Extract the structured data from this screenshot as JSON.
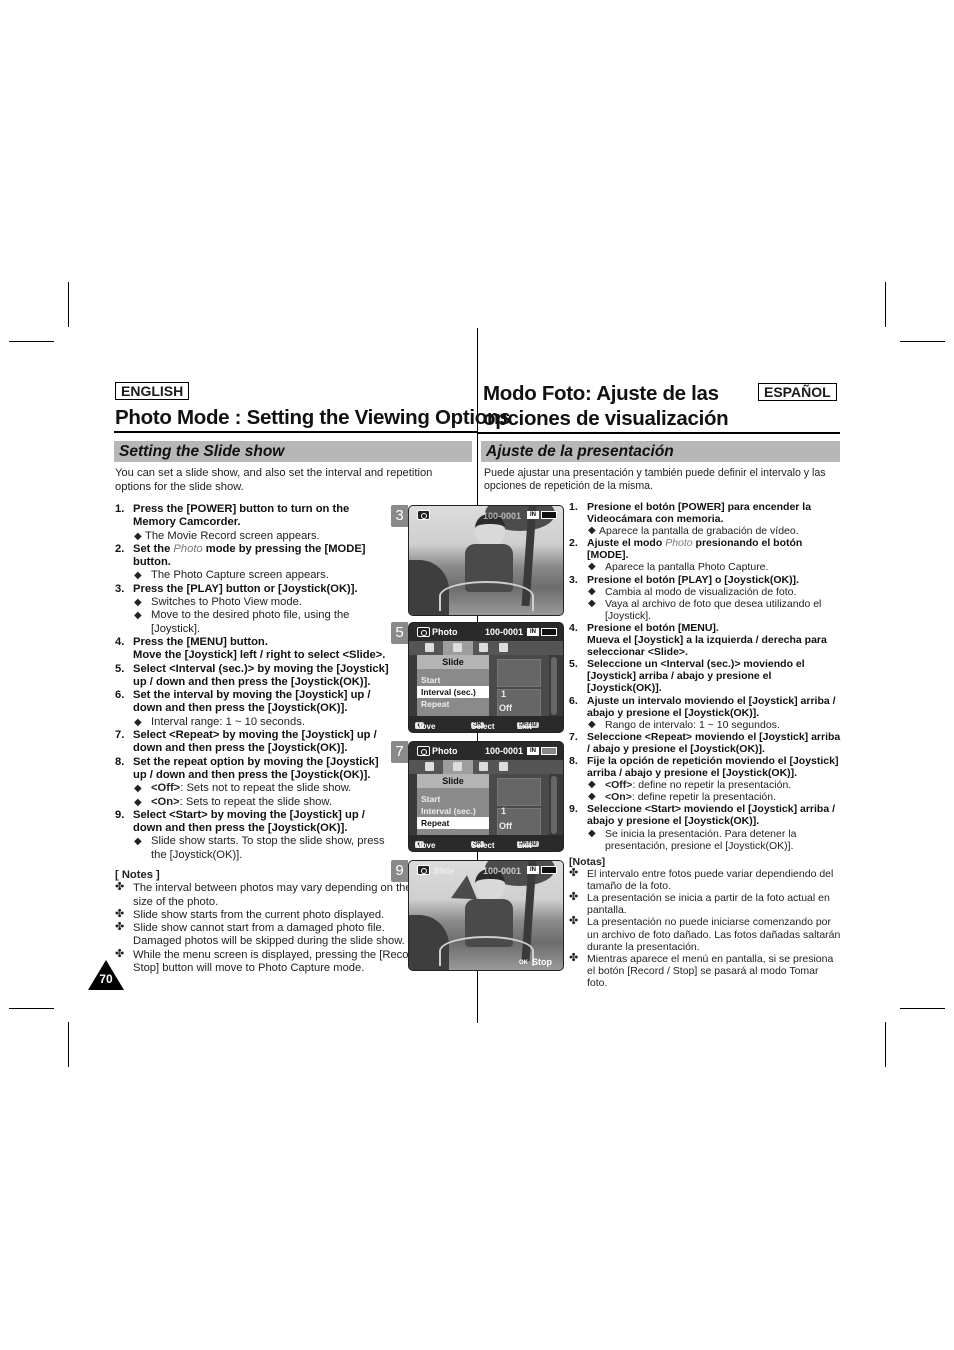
{
  "english": {
    "lang_label": "ENGLISH",
    "title": "Photo Mode : Setting the Viewing Options",
    "section": "Setting the Slide show",
    "intro": "You can set a slide show, and also set the interval and repetition options for the slide show.",
    "steps": [
      {
        "num": "1.",
        "text": "Press the [POWER] button to turn on the Memory Camcorder.",
        "subs": [
          "The Movie Record screen appears."
        ]
      },
      {
        "num": "2.",
        "pre": "Set the ",
        "italic": "Photo",
        "post": " mode by pressing the [MODE] button.",
        "subs": [
          "The Photo Capture screen appears."
        ]
      },
      {
        "num": "3.",
        "text": "Press the [PLAY] button or [Joystick(OK)].",
        "subs": [
          "Switches to Photo View mode.",
          "Move to the desired photo file, using the [Joystick]."
        ]
      },
      {
        "num": "4.",
        "text": "Press the [MENU] button.",
        "text2": "Move the [Joystick] left / right to select <Slide>."
      },
      {
        "num": "5.",
        "text": "Select <Interval (sec.)> by moving the [Joystick] up / down and then press the [Joystick(OK)]."
      },
      {
        "num": "6.",
        "text": "Set the interval by moving the [Joystick] up / down and then press the [Joystick(OK)].",
        "subs": [
          "Interval range: 1 ~ 10 seconds."
        ]
      },
      {
        "num": "7.",
        "text": "Select <Repeat> by moving the [Joystick] up / down and then press the [Joystick(OK)]."
      },
      {
        "num": "8.",
        "text": "Set the repeat option by moving the [Joystick] up / down and then press the [Joystick(OK)].",
        "subs_bold": [
          {
            "b": "<Off>",
            "t": ": Sets not to repeat the slide show."
          },
          {
            "b": "<On>",
            "t": ": Sets to repeat the slide show."
          }
        ]
      },
      {
        "num": "9.",
        "text": "Select <Start> by moving the [Joystick] up / down and then press the [Joystick(OK)].",
        "subs": [
          "Slide show starts. To stop the slide show, press the [Joystick(OK)]."
        ]
      }
    ],
    "notes_header": "[ Notes ]",
    "notes": [
      "The interval between photos may vary depending on the size of the photo.",
      "Slide show starts from the current photo displayed.",
      "Slide show cannot start from a damaged photo file. Damaged photos will be skipped during the slide show.",
      "While the menu screen is displayed, pressing the [Record / Stop] button will move to Photo Capture mode."
    ],
    "page_number": "70"
  },
  "spanish": {
    "lang_label": "ESPAÑOL",
    "title_line1": "Modo Foto: Ajuste de las",
    "title_line2": "opciones de visualización",
    "section": "Ajuste de la presentación",
    "intro": "Puede ajustar una presentación y también puede definir el intervalo y las opciones de repetición de la misma.",
    "steps": [
      {
        "num": "1.",
        "text": "Presione el botón [POWER] para encender la Videocámara con memoria.",
        "subs": [
          "Aparece la pantalla de grabación de vídeo."
        ]
      },
      {
        "num": "2.",
        "pre": "Ajuste el modo ",
        "italic": "Photo",
        "post": " presionando el botón [MODE].",
        "subs": [
          "Aparece la pantalla Photo Capture."
        ]
      },
      {
        "num": "3.",
        "text": "Presione el botón [PLAY] o [Joystick(OK)].",
        "subs": [
          "Cambia al modo de visualización de foto.",
          "Vaya al archivo de foto que desea utilizando el [Joystick]."
        ]
      },
      {
        "num": "4.",
        "text": "Presione el botón [MENU].",
        "text2": "Mueva el [Joystick] a la izquierda / derecha para seleccionar <Slide>."
      },
      {
        "num": "5.",
        "text": "Seleccione un <Interval (sec.)> moviendo el [Joystick] arriba / abajo y presione el [Joystick(OK)]."
      },
      {
        "num": "6.",
        "text": "Ajuste un intervalo moviendo el [Joystick] arriba / abajo y presione el [Joystick(OK)].",
        "subs": [
          "Rango de intervalo: 1 ~ 10 segundos."
        ]
      },
      {
        "num": "7.",
        "text": "Seleccione <Repeat> moviendo el [Joystick] arriba / abajo y presione el [Joystick(OK)]."
      },
      {
        "num": "8.",
        "text": "Fije la opción de repetición moviendo el [Joystick] arriba / abajo y presione el [Joystick(OK)].",
        "subs_bold": [
          {
            "b": "<Off>",
            "t": ": define no repetir la presentación."
          },
          {
            "b": "<On>",
            "t": ": define repetir la presentación."
          }
        ]
      },
      {
        "num": "9.",
        "text": "Seleccione <Start> moviendo el [Joystick] arriba / abajo y presione el [Joystick(OK)].",
        "subs": [
          "Se inicia la presentación. Para detener la presentación, presione el [Joystick(OK)]."
        ]
      }
    ],
    "notes_header": "[Notas]",
    "notes": [
      "El intervalo entre fotos puede variar dependiendo del tamaño de la foto.",
      "La presentación se inicia a partir de la foto actual en pantalla.",
      "La presentación no puede iniciarse comenzando por un archivo de foto dañado. Las fotos dañadas saltarán durante la presentación.",
      "Mientras aparece el menú en pantalla, si se presiona el botón [Record / Stop] se pasará al modo Tomar foto."
    ]
  },
  "screens": {
    "s3": {
      "label": "3",
      "file": "100-0001"
    },
    "s5": {
      "label": "5",
      "mode": "Photo",
      "file": "100-0001",
      "menu_title": "Slide",
      "items": [
        "Start",
        "Interval (sec.)",
        "Repeat"
      ],
      "active": 1,
      "interval_value": "1",
      "repeat_value": "Off",
      "bottom_move": "Move",
      "bottom_select": "Select",
      "bottom_exit": "Exit",
      "ok_key": "OK",
      "menu_key": "MENU"
    },
    "s7": {
      "label": "7",
      "mode": "Photo",
      "file": "100-0001",
      "menu_title": "Slide",
      "items": [
        "Start",
        "Interval (sec.)",
        "Repeat"
      ],
      "active": 2,
      "interval_value": "1",
      "repeat_value": "Off",
      "bottom_move": "Move",
      "bottom_select": "Select",
      "bottom_exit": "Exit",
      "ok_key": "OK",
      "menu_key": "MENU"
    },
    "s9": {
      "label": "9",
      "mode": "Slide",
      "file": "100-0001",
      "stop": "Stop",
      "ok_key": "OK"
    }
  }
}
